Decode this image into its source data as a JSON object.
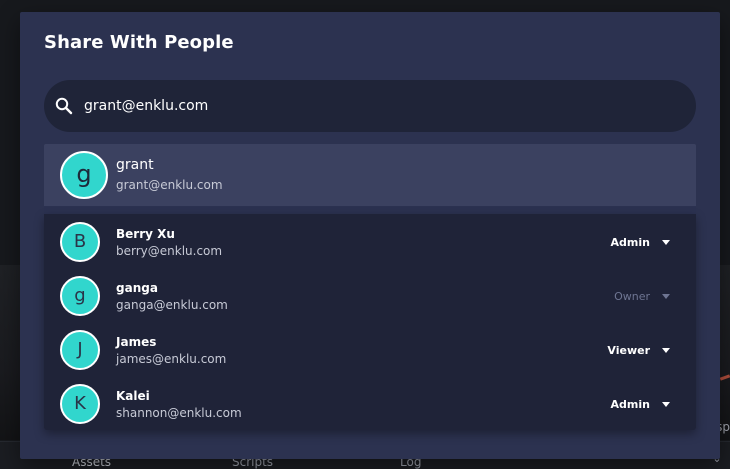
{
  "background": {
    "bottom_tabs": [
      "Assets",
      "Scripts",
      "Log"
    ],
    "right_edge_text": "sp"
  },
  "dialog": {
    "title": "Share With People",
    "search": {
      "value": "grant@enklu.com",
      "icon": "search-icon"
    },
    "suggestion": {
      "initial": "g",
      "name": "grant",
      "email": "grant@enklu.com"
    },
    "members": [
      {
        "initial": "B",
        "name": "Berry Xu",
        "email": "berry@enklu.com",
        "role": "Admin",
        "role_disabled": false
      },
      {
        "initial": "g",
        "name": "ganga",
        "email": "ganga@enklu.com",
        "role": "Owner",
        "role_disabled": true
      },
      {
        "initial": "J",
        "name": "James",
        "email": "james@enklu.com",
        "role": "Viewer",
        "role_disabled": false
      },
      {
        "initial": "K",
        "name": "Kalei",
        "email": "shannon@enklu.com",
        "role": "Admin",
        "role_disabled": false
      }
    ]
  },
  "colors": {
    "modal_bg": "#2c3250",
    "input_bg": "#1f2438",
    "suggestion_bg": "#3b4160",
    "list_bg": "#1f2338",
    "avatar": "#31d6cd",
    "disabled_text": "#6e7592"
  }
}
